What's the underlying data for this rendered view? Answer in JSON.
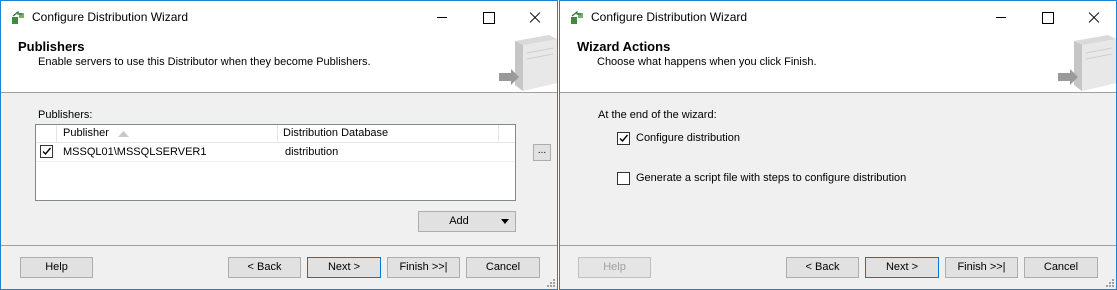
{
  "left": {
    "title": "Configure Distribution Wizard",
    "header": {
      "title": "Publishers",
      "description": "Enable servers to use this Distributor when they become Publishers."
    },
    "publishers_label": "Publishers:",
    "columns": [
      "Publisher",
      "Distribution Database"
    ],
    "rows": [
      {
        "publisher": "MSSQL01\\MSSQLSERVER1",
        "database": "distribution",
        "checked": true
      }
    ],
    "ellipsis": "...",
    "add_label": "Add",
    "buttons": {
      "help": "Help",
      "back": "< Back",
      "next": "Next >",
      "finish": "Finish >>|",
      "cancel": "Cancel"
    }
  },
  "right": {
    "title": "Configure Distribution Wizard",
    "header": {
      "title": "Wizard Actions",
      "description": "Choose what happens when you click Finish."
    },
    "intro": "At the end of the wizard:",
    "options": [
      {
        "label": "Configure distribution",
        "checked": true
      },
      {
        "label": "Generate a script file with steps to configure distribution",
        "checked": false
      }
    ],
    "buttons": {
      "help": "Help",
      "back": "< Back",
      "next": "Next >",
      "finish": "Finish >>|",
      "cancel": "Cancel"
    },
    "help_disabled": true
  },
  "icons": [
    "wizard-app-icon",
    "minimize-icon",
    "maximize-icon",
    "close-icon",
    "server-graphic-icon",
    "sort-ascending-icon",
    "checkbox-checked-icon",
    "dropdown-arrow-icon",
    "resize-grip-icon"
  ]
}
